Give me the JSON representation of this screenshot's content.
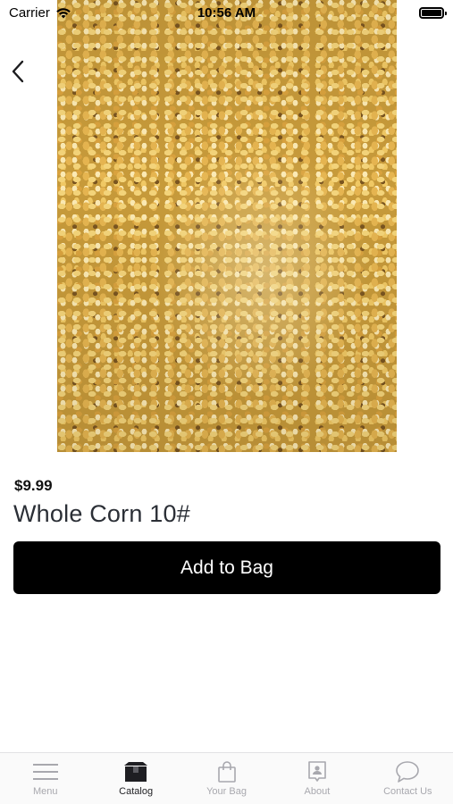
{
  "status_bar": {
    "carrier": "Carrier",
    "time": "10:56 AM"
  },
  "product": {
    "price": "$9.99",
    "title": "Whole Corn 10#",
    "image_icon": "corn-photo"
  },
  "actions": {
    "add_to_bag_label": "Add to Bag"
  },
  "tab_bar": {
    "active": "Catalog",
    "items": [
      {
        "label": "Menu",
        "icon": "hamburger-icon"
      },
      {
        "label": "Catalog",
        "icon": "box-icon"
      },
      {
        "label": "Your Bag",
        "icon": "bag-icon"
      },
      {
        "label": "About",
        "icon": "contact-card-icon"
      },
      {
        "label": "Contact Us",
        "icon": "chat-bubble-icon"
      }
    ]
  },
  "colors": {
    "button_bg": "#000000",
    "tab_active": "#1e1e22",
    "tab_inactive": "#a8a8ae"
  }
}
